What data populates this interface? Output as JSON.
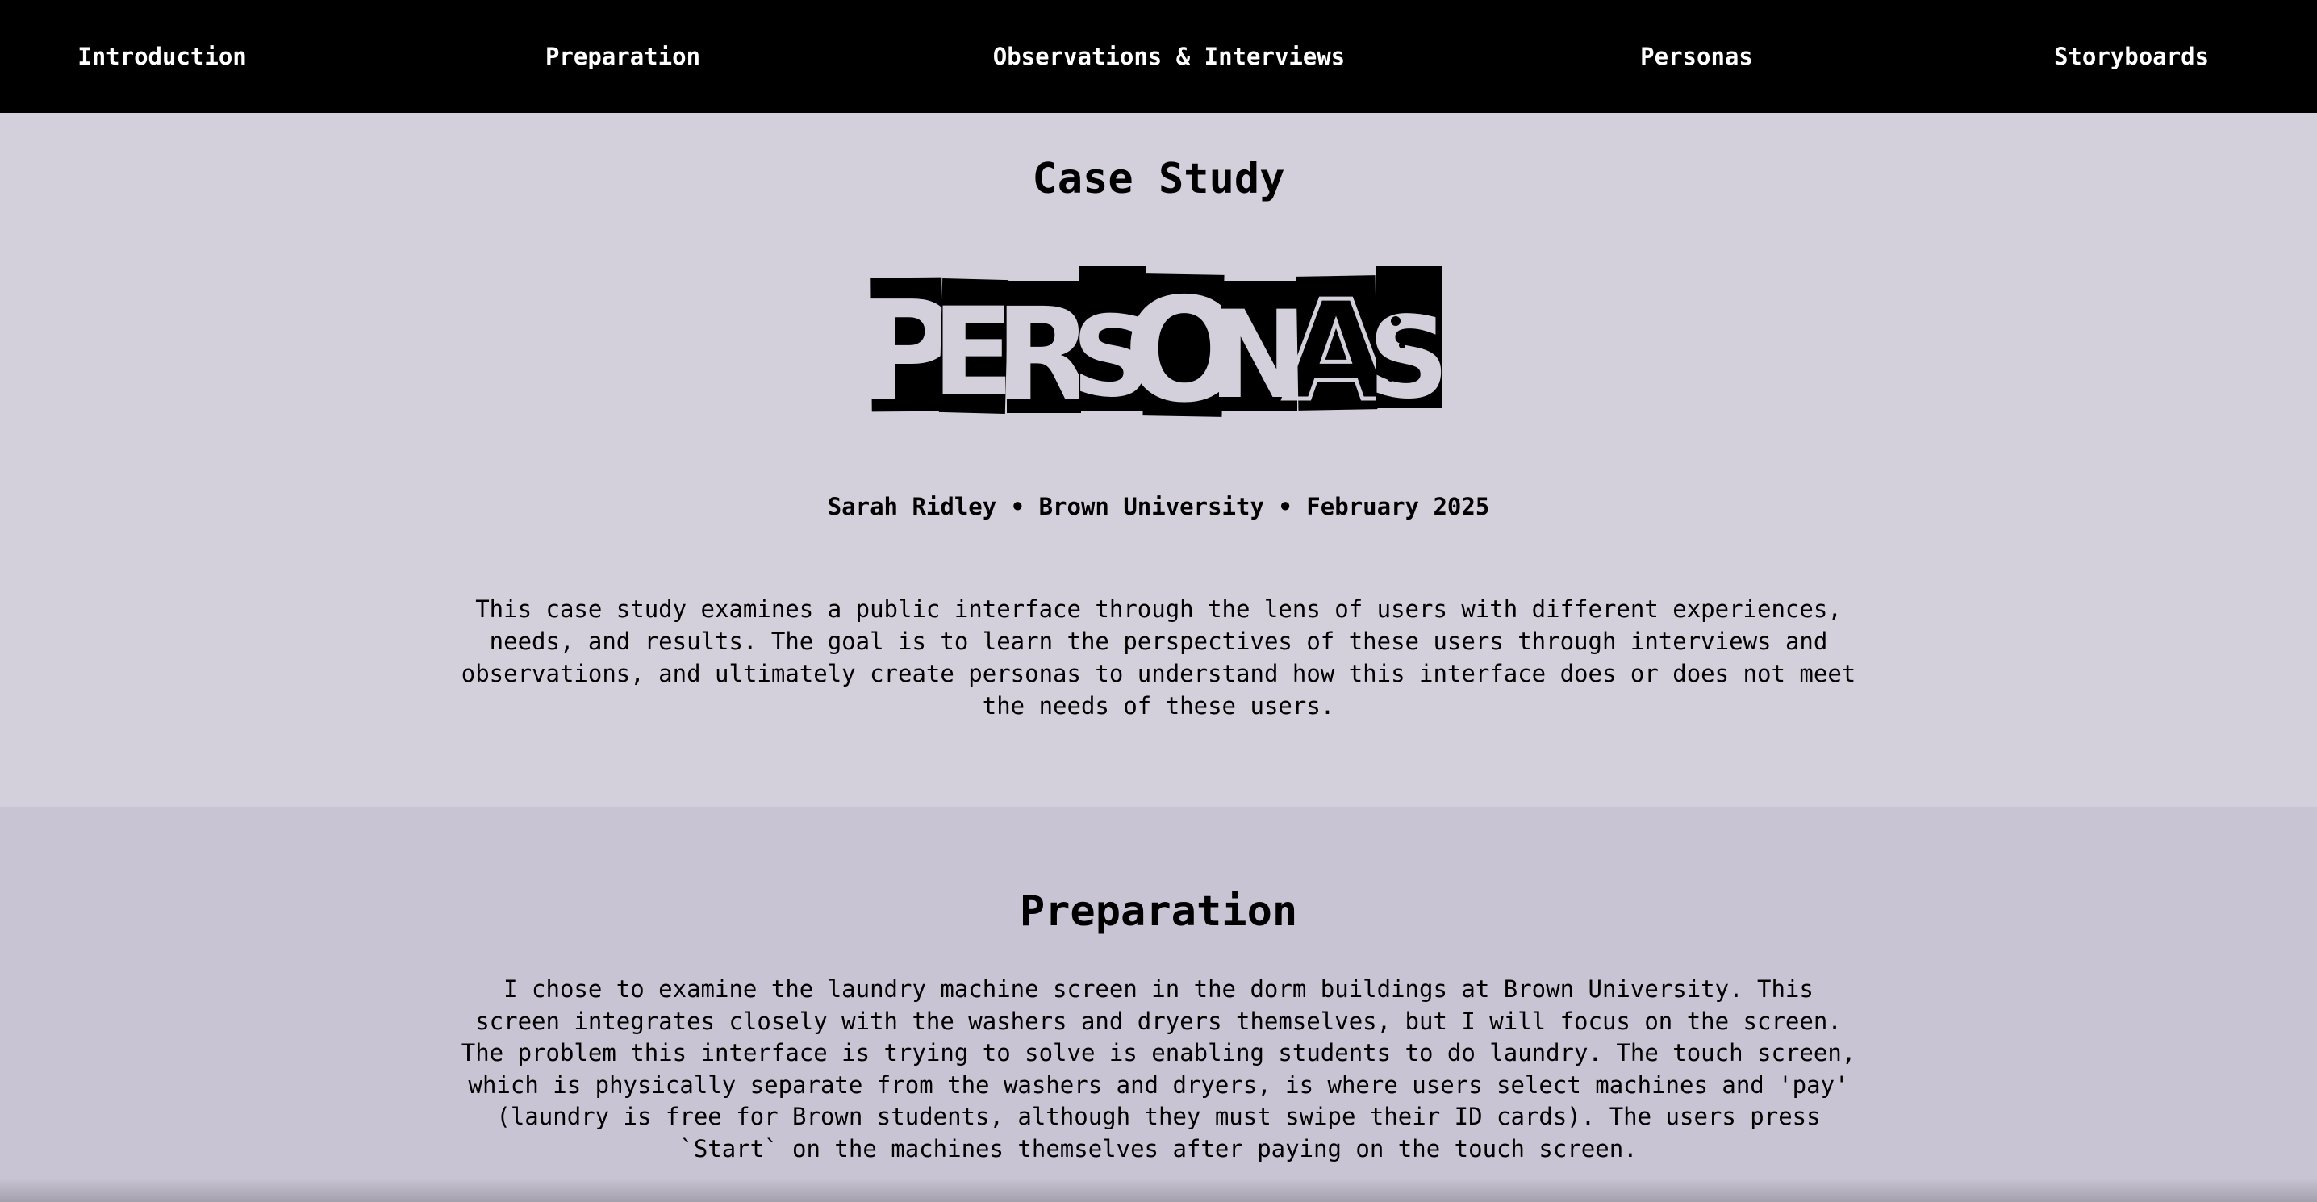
{
  "nav": {
    "items": [
      {
        "label": "Introduction"
      },
      {
        "label": "Preparation"
      },
      {
        "label": "Observations & Interviews"
      },
      {
        "label": "Personas"
      },
      {
        "label": "Storyboards"
      }
    ]
  },
  "intro": {
    "title": "Case Study",
    "logo_text": "PERSONAS",
    "byline": "Sarah Ridley • Brown University • February 2025",
    "description": "This case study examines a public interface through the lens of users with different experiences, needs, and results. The goal is to learn the perspectives of these users through interviews and observations, and ultimately create personas to understand how this interface does or does not meet the needs of these users."
  },
  "preparation": {
    "title": "Preparation",
    "description": "I chose to examine the laundry machine screen in the dorm buildings at Brown University. This screen integrates closely with the washers and dryers themselves, but I will focus on the screen. The problem this interface is trying to solve is enabling students to do laundry. The touch screen, which is physically separate from the washers and dryers, is where users select machines and 'pay' (laundry is free for Brown students, although they must swipe their ID cards). The users press `Start` on the machines themselves after paying on the touch screen."
  },
  "colors": {
    "nav_bg": "#000000",
    "nav_text": "#ffffff",
    "intro_bg": "#d3d0dc",
    "prep_bg": "#c8c4d3",
    "text": "#000000"
  }
}
